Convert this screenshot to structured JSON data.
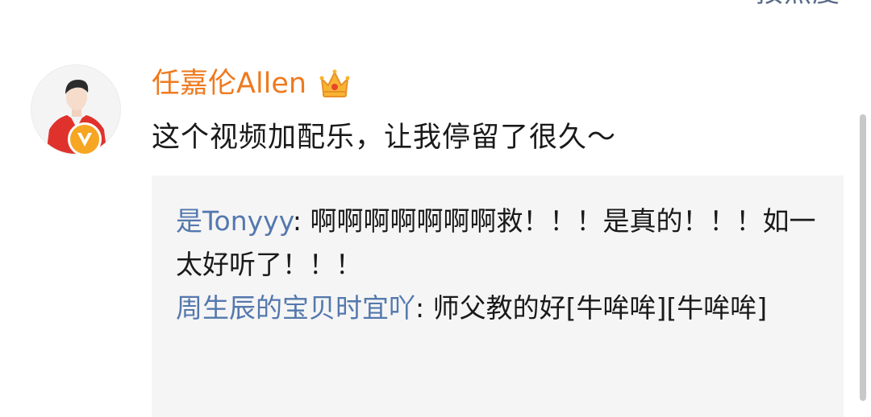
{
  "header": {
    "sort_label": "按热度"
  },
  "comment": {
    "username": "任嘉伦Allen",
    "text": "这个视频加配乐，让我停留了很久～",
    "avatar_icon": "user-avatar",
    "verified_icon": "verified-v-icon",
    "badge_icon": "crown-icon"
  },
  "replies": [
    {
      "user": "是Tonyyy",
      "separator": ": ",
      "text": "啊啊啊啊啊啊啊救！！！是真的！！！如一太好听了！！！"
    },
    {
      "user": "周生辰的宝贝时宜吖",
      "separator": ": ",
      "text": "师父教的好[牛哞哞][牛哞哞]"
    }
  ],
  "colors": {
    "username": "#ef7a1f",
    "reply_user": "#5478ad",
    "reply_bg": "#f5f5f5",
    "verified": "#f6a623"
  }
}
